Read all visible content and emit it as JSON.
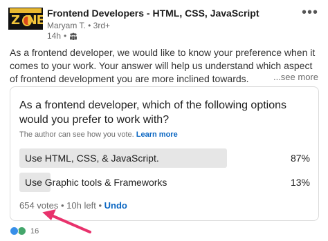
{
  "header": {
    "group_name": "Frontend Developers - HTML, CSS, JavaScript",
    "author": "Maryam T. • 3rd+",
    "time": "14h",
    "more_icon": "ellipsis-icon"
  },
  "post": {
    "text": "As a frontend developer, we would like to know your preference when it comes to your work. Your answer will help us understand which aspect of frontend development you are more inclined towards.",
    "see_more": "...see more"
  },
  "poll": {
    "question": "As a frontend developer, which of the following options would you prefer to work with?",
    "note": "The author can see how you vote.",
    "learn_more": "Learn more",
    "options": [
      {
        "label": "Use HTML, CSS, & JavaScript.",
        "percent": "87%",
        "fraction": 0.87
      },
      {
        "label": "Use Graphic tools & Frameworks",
        "percent": "13%",
        "fraction": 0.13
      }
    ],
    "votes": "654 votes",
    "time_left": "10h left",
    "undo": "Undo"
  },
  "reactions": {
    "count": "16",
    "icons": [
      "like-icon",
      "celebrate-icon"
    ]
  },
  "colors": {
    "link": "#0a66c2",
    "bar": "#e6e6e6",
    "arrow": "#e8326c"
  }
}
